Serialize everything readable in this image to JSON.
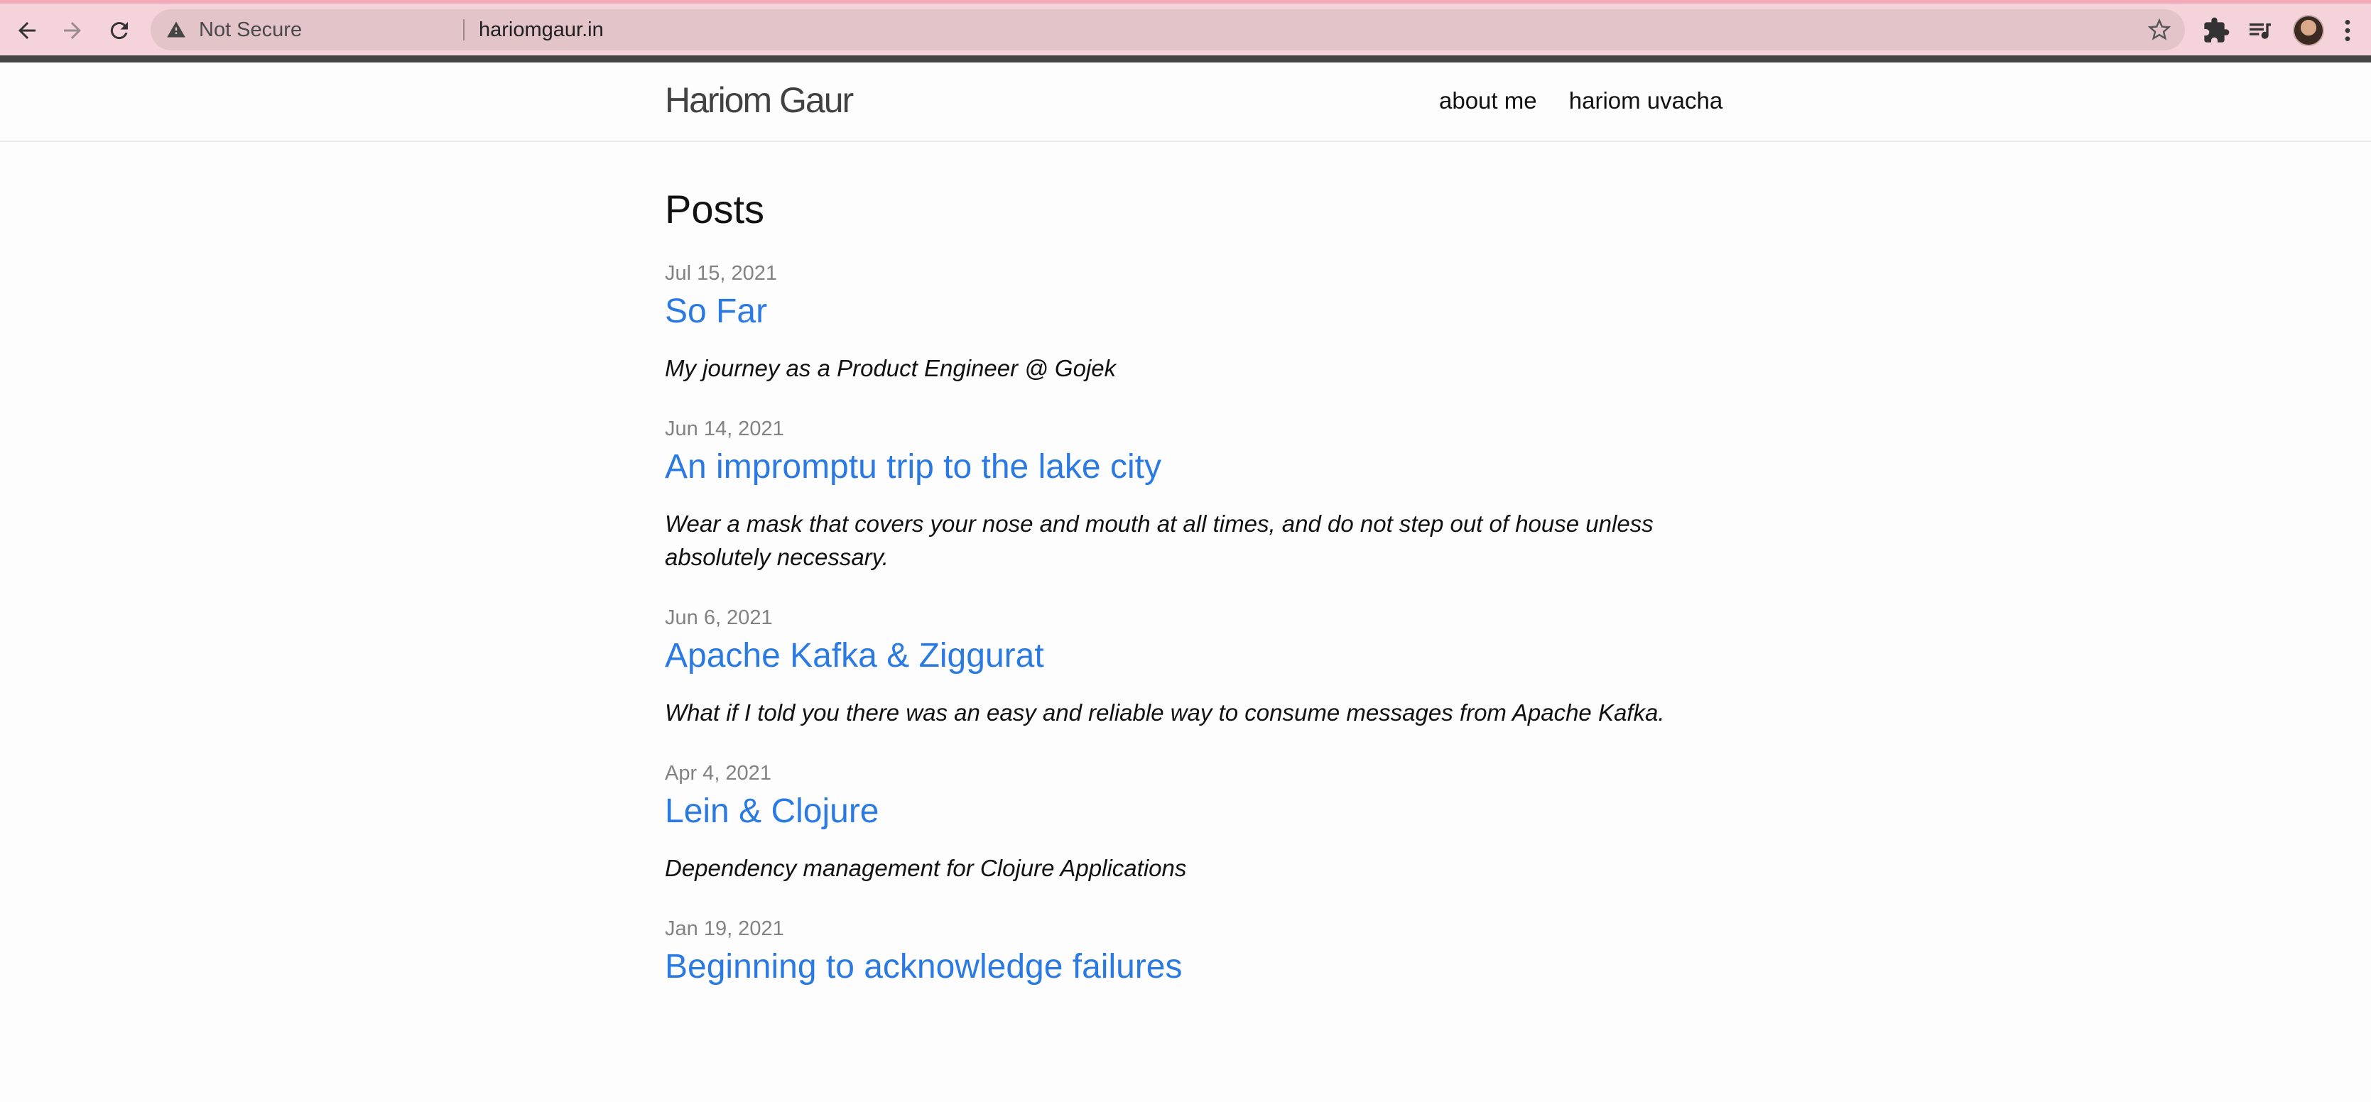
{
  "browser": {
    "security_label": "Not Secure",
    "url": "hariomgaur.in"
  },
  "site": {
    "title": "Hariom Gaur",
    "nav": [
      {
        "label": "about me"
      },
      {
        "label": "hariom uvacha"
      }
    ]
  },
  "page": {
    "heading": "Posts",
    "posts": [
      {
        "date": "Jul 15, 2021",
        "title": "So Far",
        "excerpt": "My journey as a Product Engineer @ Gojek"
      },
      {
        "date": "Jun 14, 2021",
        "title": "An impromptu trip to the lake city",
        "excerpt": "Wear a mask that covers your nose and mouth at all times, and do not step out of house unless absolutely necessary."
      },
      {
        "date": "Jun 6, 2021",
        "title": "Apache Kafka & Ziggurat",
        "excerpt": "What if I told you there was an easy and reliable way to consume messages from Apache Kafka."
      },
      {
        "date": "Apr 4, 2021",
        "title": "Lein & Clojure",
        "excerpt": "Dependency management for Clojure Applications"
      },
      {
        "date": "Jan 19, 2021",
        "title": "Beginning to acknowledge failures",
        "excerpt": ""
      }
    ]
  },
  "colors": {
    "link": "#2a7ae2",
    "meta": "#828282",
    "toolbar": "#f5d3da"
  }
}
